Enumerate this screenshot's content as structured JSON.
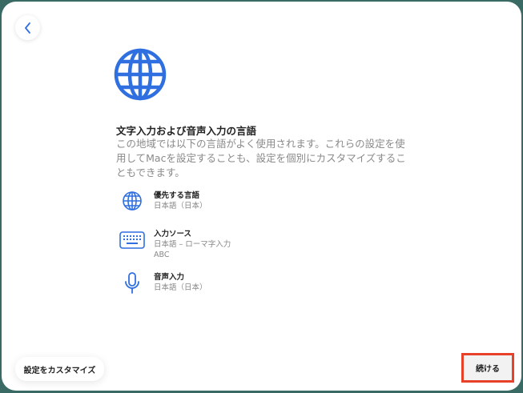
{
  "title": "文字入力および音声入力の言語",
  "description": "この地域では以下の言語がよく使用されます。これらの設定を使用してMacを設定することも、設定を個別にカスタマイズすることもできます。",
  "items": [
    {
      "label": "優先する言語",
      "values": [
        "日本語（日本）"
      ],
      "icon": "globe-icon"
    },
    {
      "label": "入力ソース",
      "values": [
        "日本語 – ローマ字入力",
        "ABC"
      ],
      "icon": "keyboard-icon"
    },
    {
      "label": "音声入力",
      "values": [
        "日本語（日本）"
      ],
      "icon": "microphone-icon"
    }
  ],
  "buttons": {
    "customize": "設定をカスタマイズ",
    "continue": "続ける"
  },
  "colors": {
    "accent": "#2f6fe0",
    "highlight": "#e8412a"
  }
}
